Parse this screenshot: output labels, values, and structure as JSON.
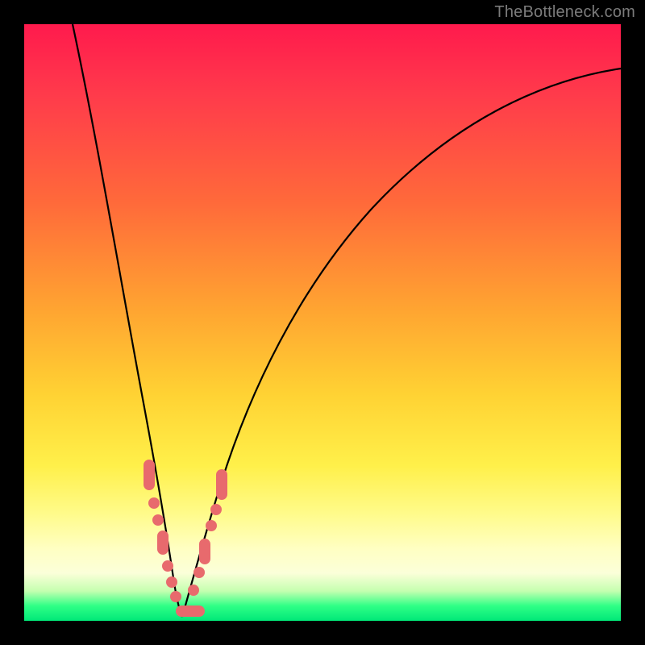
{
  "watermark": "TheBottleneck.com",
  "colors": {
    "frame": "#000000",
    "gradient_top": "#ff1a4d",
    "gradient_mid": "#ffd233",
    "gradient_bottom_band": "#00e878",
    "curve": "#000000",
    "markers": "#e86a6d"
  },
  "chart_data": {
    "type": "line",
    "title": "",
    "xlabel": "",
    "ylabel": "",
    "xlim": [
      0,
      100
    ],
    "ylim": [
      0,
      100
    ],
    "note": "Two smooth curves forming a V; minimum near x≈25 at y≈0. Left branch rises steeply toward top-left; right branch rises with decreasing slope toward upper-right. Pink markers cluster near the valley on both branches.",
    "series": [
      {
        "name": "left-branch",
        "x": [
          8,
          10,
          12,
          14,
          16,
          18,
          20,
          22,
          23.5,
          24.5,
          25.3
        ],
        "values": [
          100,
          86,
          73,
          60,
          48,
          37,
          27,
          18,
          12,
          6,
          1
        ]
      },
      {
        "name": "right-branch",
        "x": [
          25.3,
          27,
          29,
          31,
          34,
          38,
          43,
          50,
          58,
          67,
          77,
          88,
          100
        ],
        "values": [
          1,
          7,
          14,
          20,
          28,
          37,
          46,
          56,
          65,
          73,
          80,
          85,
          88
        ]
      }
    ],
    "markers": [
      {
        "branch": "left",
        "x": 20.6,
        "y": 25.0
      },
      {
        "branch": "left",
        "x": 21.0,
        "y": 22.3
      },
      {
        "branch": "left",
        "x": 21.5,
        "y": 20.1
      },
      {
        "branch": "left",
        "x": 22.5,
        "y": 15.8
      },
      {
        "branch": "left",
        "x": 23.1,
        "y": 12.5
      },
      {
        "branch": "left",
        "x": 23.8,
        "y": 9.0
      },
      {
        "branch": "left",
        "x": 24.3,
        "y": 6.4
      },
      {
        "branch": "left",
        "x": 24.8,
        "y": 4.0
      },
      {
        "branch": "left",
        "x": 25.1,
        "y": 2.4
      },
      {
        "branch": "valley",
        "x": 25.6,
        "y": 1.2
      },
      {
        "branch": "valley",
        "x": 26.3,
        "y": 1.0
      },
      {
        "branch": "valley",
        "x": 27.1,
        "y": 1.2
      },
      {
        "branch": "right",
        "x": 27.8,
        "y": 4.5
      },
      {
        "branch": "right",
        "x": 28.6,
        "y": 8.2
      },
      {
        "branch": "right",
        "x": 29.6,
        "y": 12.2
      },
      {
        "branch": "right",
        "x": 30.4,
        "y": 15.8
      },
      {
        "branch": "right",
        "x": 31.2,
        "y": 18.7
      },
      {
        "branch": "right",
        "x": 31.9,
        "y": 21.2
      },
      {
        "branch": "right",
        "x": 32.6,
        "y": 24.0
      }
    ]
  }
}
